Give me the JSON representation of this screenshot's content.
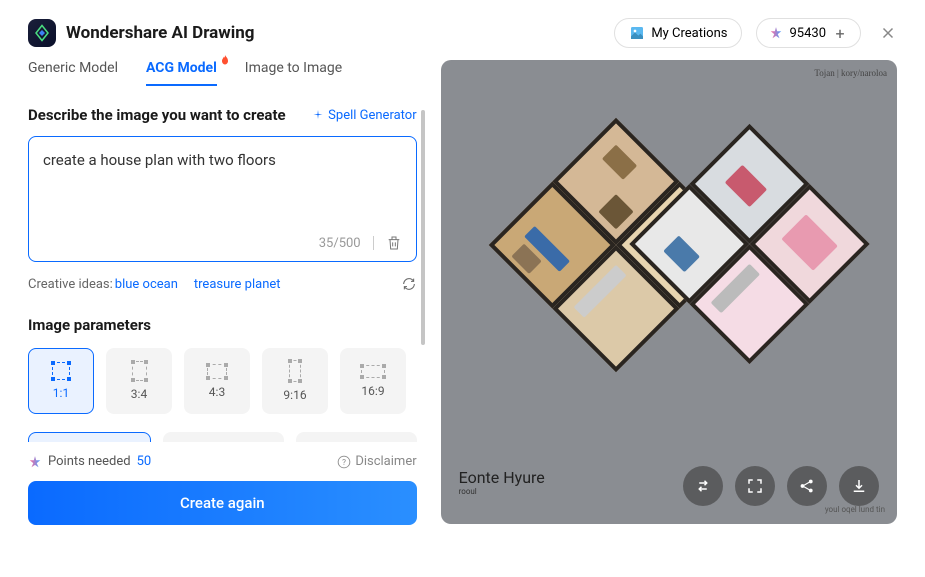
{
  "header": {
    "app_title": "Wondershare AI Drawing",
    "my_creations": "My Creations",
    "points": "95430"
  },
  "tabs": {
    "generic": "Generic Model",
    "acg": "ACG Model",
    "i2i": "Image to Image"
  },
  "prompt": {
    "label": "Describe the image you want to create",
    "spell": "Spell Generator",
    "text": "create a house plan with two floors",
    "counter": "35/500"
  },
  "ideas": {
    "label": "Creative ideas:",
    "idea1": "blue ocean",
    "idea2": "treasure planet"
  },
  "params": {
    "label": "Image parameters",
    "ratios": [
      "1:1",
      "3:4",
      "4:3",
      "9:16",
      "16:9"
    ]
  },
  "bottom": {
    "points_label": "Points needed",
    "points_value": "50",
    "disclaimer": "Disclaimer",
    "create": "Create again"
  },
  "preview": {
    "watermark_tr": "Tojan | kory/naroloa",
    "signature": "Eonte Hyure",
    "signature_sub": "rooul",
    "watermark_br": "youl oqel lund tin"
  }
}
